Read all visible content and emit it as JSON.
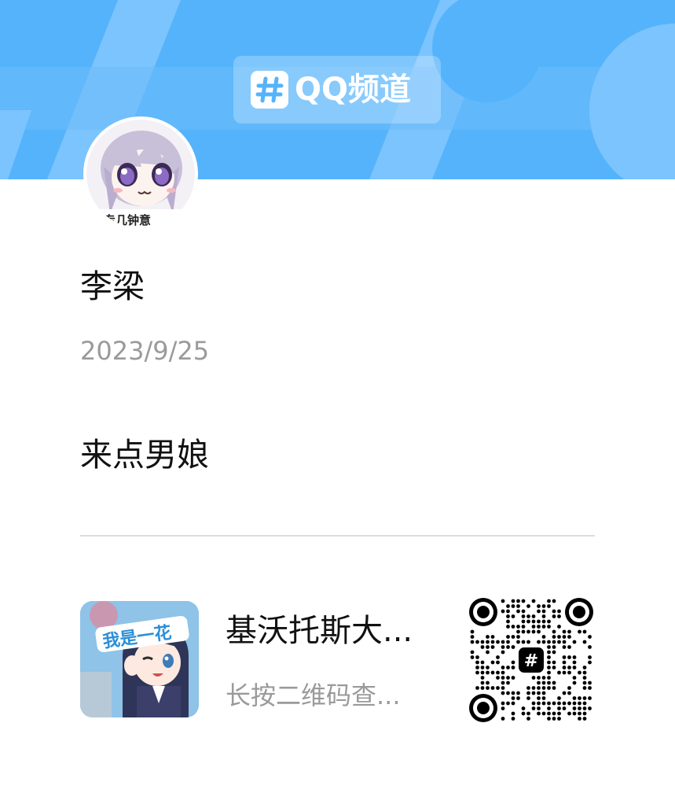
{
  "header": {
    "logo_mark": "#",
    "logo_text": "QQ频道",
    "background_color": "#55b3fb"
  },
  "post": {
    "author_name": "李梁",
    "date": "2023/9/25",
    "content": "来点男娘",
    "avatar_caption": "专几钟意"
  },
  "channel": {
    "name": "基沃托斯大...",
    "hint": "长按二维码查...",
    "icon_caption": "我是一花",
    "qr_center_mark": "#"
  }
}
